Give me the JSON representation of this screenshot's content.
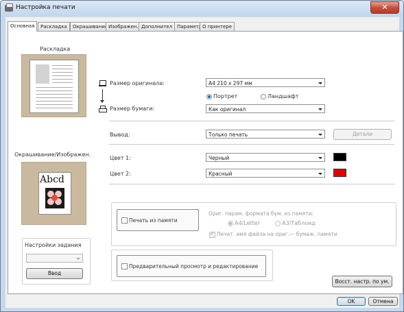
{
  "window": {
    "title": "Настройка печати",
    "close_glyph": "✕"
  },
  "tabs": [
    {
      "label": "Основная",
      "active": true
    },
    {
      "label": "Раскладка"
    },
    {
      "label": "Окрашивание"
    },
    {
      "label": "Изображен."
    },
    {
      "label": "Дополнител"
    },
    {
      "label": "Параметр"
    },
    {
      "label": "О принтере"
    }
  ],
  "left": {
    "layout_title": "Раскладка",
    "coloring_title": "Окрашивание/Изображен.",
    "preview_text": "Abcd",
    "job_settings_label": "Настройки задания",
    "job_settings_value": "",
    "enter_button": "Ввод"
  },
  "paper": {
    "original_size_label": "Размер оригинала:",
    "original_size_value": "A4 210 x 297 мм",
    "portrait": "Портрет",
    "landscape": "Ландшафт",
    "orientation_selected": "portrait",
    "paper_size_label": "Размер бумаги:",
    "paper_size_value": "Как оригинал"
  },
  "output": {
    "label": "Вывод:",
    "value": "Только печать",
    "details_button": "Детали"
  },
  "colors": {
    "color1_label": "Цвет 1:",
    "color1_value": "Черный",
    "color1_hex": "#000000",
    "color2_label": "Цвет 2:",
    "color2_value": "Красный",
    "color2_hex": "#e00000"
  },
  "memory": {
    "checkbox_label": "Печать из памяти",
    "orig_param_label": "Ориг. парам. формата бум. из памяти:",
    "radio_a4": "A4/Letter",
    "radio_a3": "A3/Таблоид",
    "print_filename": "Печат. имя файла на ориг.— бумаж. памяти"
  },
  "preview_edit": {
    "checkbox_label": "Предварительный просмотр и редактирование"
  },
  "buttons": {
    "restore_defaults": "Восст. настр. по ум.",
    "ok": "OK",
    "cancel": "Отмена"
  }
}
